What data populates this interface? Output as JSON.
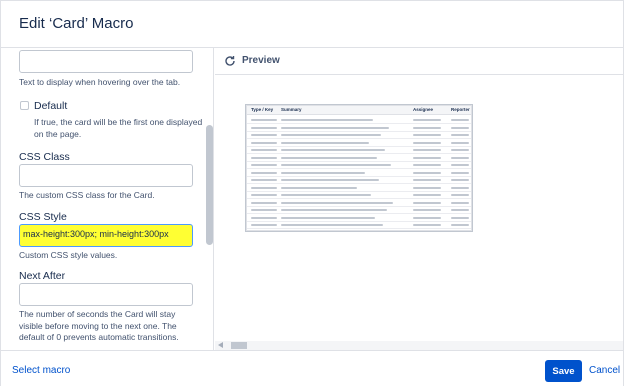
{
  "dialog": {
    "title": "Edit ‘Card’ Macro"
  },
  "left": {
    "tooltip_help": "Text to display when hovering over the tab.",
    "default_label": "Default",
    "default_help": "If true, the card will be the first one displayed on the page.",
    "css_class_label": "CSS Class",
    "css_class_value": "",
    "css_class_help": "The custom CSS class for the Card.",
    "css_style_label": "CSS Style",
    "css_style_value": "max-height:300px; min-height:300px",
    "css_style_help": "Custom CSS style values.",
    "next_after_label": "Next After",
    "next_after_value": "",
    "next_after_help": "The number of seconds the Card will stay visible before moving to the next one. The default of 0 prevents automatic transitions."
  },
  "preview": {
    "label": "Preview",
    "icon": "refresh-icon",
    "thumbnail_columns": [
      "Type / Key",
      "Summary",
      "Assignee",
      "Reporter"
    ]
  },
  "footer": {
    "select_macro": "Select macro",
    "save": "Save",
    "cancel": "Cancel"
  },
  "colors": {
    "accent": "#0052cc",
    "highlight": "#ffff33"
  }
}
